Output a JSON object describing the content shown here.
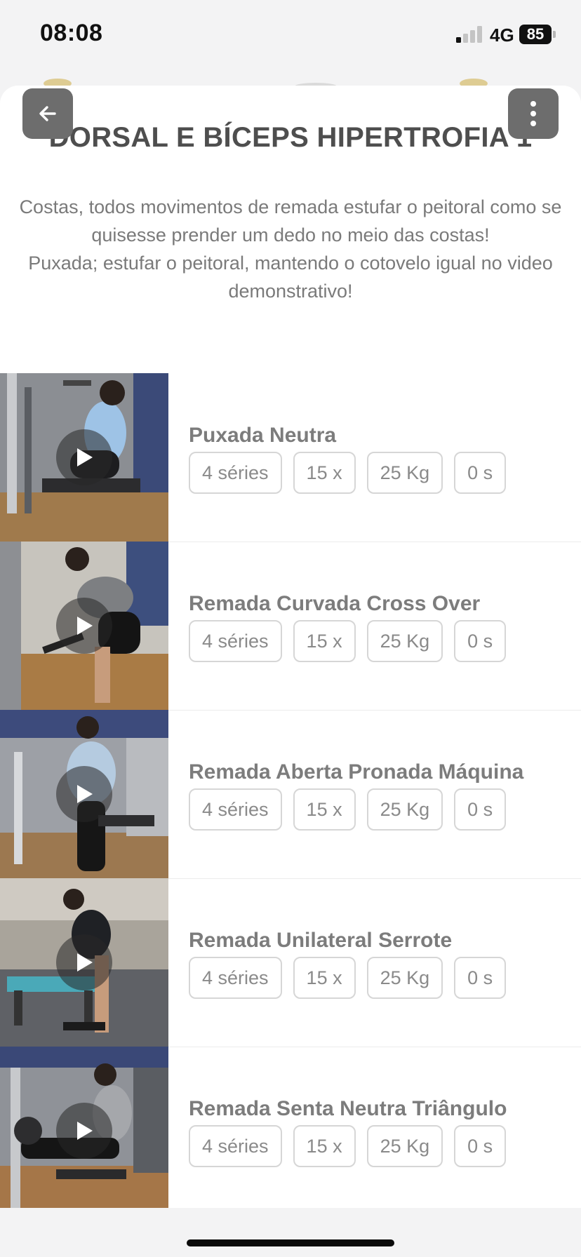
{
  "status_bar": {
    "time": "08:08",
    "network": "4G",
    "battery": "85"
  },
  "header": {
    "title": "DORSAL E BÍCEPS HIPERTROFIA 1",
    "description": "Costas, todos movimentos de remada estufar o peitoral como se quisesse prender um dedo no meio das costas!\nPuxada; estufar o peitoral, mantendo o cotovelo igual no video demonstrativo!"
  },
  "exercises": [
    {
      "name": "Puxada Neutra",
      "sets": "4 séries",
      "reps": "15 x",
      "load": "25 Kg",
      "rest": "0 s"
    },
    {
      "name": "Remada Curvada Cross Over",
      "sets": "4 séries",
      "reps": "15 x",
      "load": "25 Kg",
      "rest": "0 s"
    },
    {
      "name": "Remada Aberta Pronada Máquina",
      "sets": "4 séries",
      "reps": "15 x",
      "load": "25 Kg",
      "rest": "0 s"
    },
    {
      "name": "Remada Unilateral Serrote",
      "sets": "4 séries",
      "reps": "15 x",
      "load": "25 Kg",
      "rest": "0 s"
    },
    {
      "name": "Remada Senta Neutra Triângulo",
      "sets": "4 séries",
      "reps": "15 x",
      "load": "25 Kg",
      "rest": "0 s"
    }
  ],
  "icons": {
    "back": "arrow-left-icon",
    "more": "more-vertical-icon",
    "play": "play-icon"
  }
}
